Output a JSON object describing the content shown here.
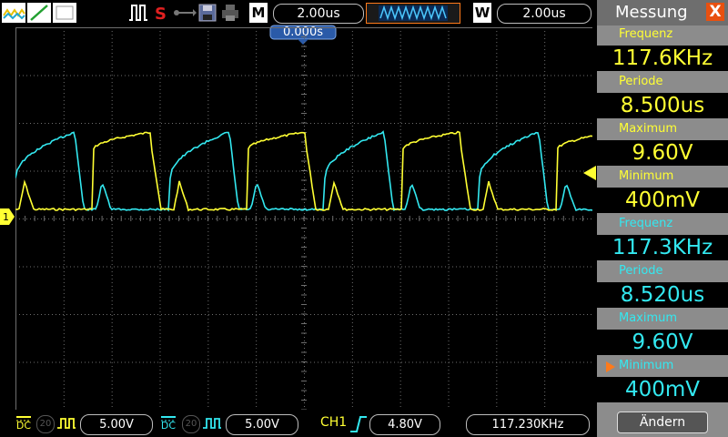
{
  "toolbar": {
    "timebase_mode": "M",
    "timebase_value": "2.00us",
    "window_mode": "W",
    "window_value": "2.00us",
    "trigger_offset": "0.000s",
    "icons": [
      "ch1-wave-icon",
      "ch2-line-icon",
      "ch-empty-icon",
      "pulse-icon",
      "s-icon",
      "usb-icon",
      "save-icon",
      "print-icon"
    ]
  },
  "bottom": {
    "ch1_coupling": "DC",
    "ch1_bw": "20",
    "ch1_volts": "5.00V",
    "ch2_coupling": "DC",
    "ch2_bw": "20",
    "ch2_volts": "5.00V",
    "trigger_source": "CH1",
    "trigger_level": "4.80V",
    "frequency": "117.230KHz"
  },
  "panel": {
    "title": "Messung",
    "close": "X",
    "ch1": [
      {
        "label": "Frequenz",
        "value": "117.6KHz"
      },
      {
        "label": "Periode",
        "value": "8.500us"
      },
      {
        "label": "Maximum",
        "value": "9.60V"
      },
      {
        "label": "Minimum",
        "value": "400mV"
      }
    ],
    "ch2": [
      {
        "label": "Frequenz",
        "value": "117.3KHz"
      },
      {
        "label": "Periode",
        "value": "8.520us"
      },
      {
        "label": "Maximum",
        "value": "9.60V"
      },
      {
        "label": "Minimum",
        "value": "400mV"
      }
    ],
    "button": "Ändern"
  },
  "colors": {
    "ch1": "#ffff33",
    "ch2": "#33e8f0",
    "accent": "#ff7a1a",
    "grid": "#777777"
  }
}
